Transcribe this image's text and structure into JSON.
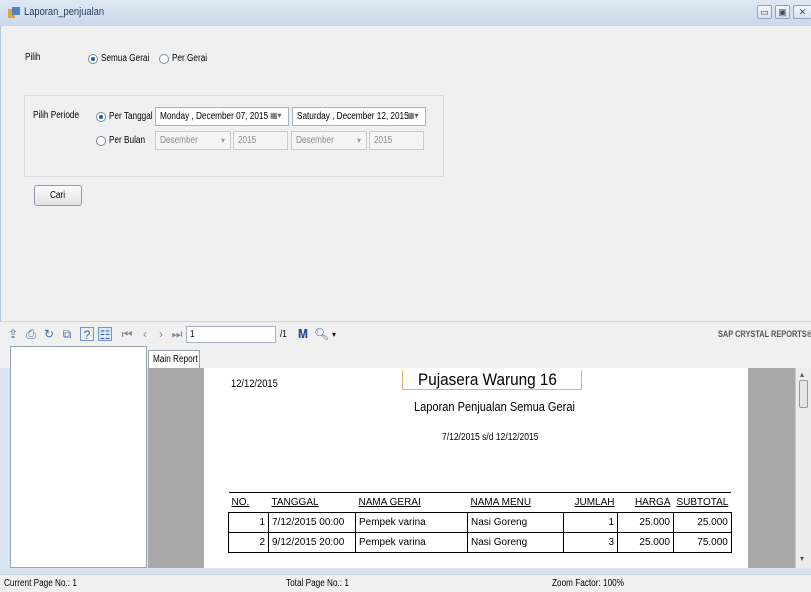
{
  "window": {
    "title": "Laporan_penjualan"
  },
  "filter": {
    "pilih_label": "Pilih",
    "opt_semua": "Semua Gerai",
    "opt_per_gerai": "Per Gerai",
    "selected": "Semua Gerai"
  },
  "periode": {
    "label": "Pilih Periode",
    "opt_tanggal": "Per Tanggal",
    "opt_bulan": "Per Bulan",
    "date_from": "Monday   , December 07, 2015",
    "date_to": "Saturday   , December 12, 2015",
    "month_from": "Desember",
    "year_from": "2015",
    "month_to": "Desember",
    "year_to": "2015"
  },
  "search_button": "Cari",
  "toolbar": {
    "page_input": "1",
    "page_total": "/1",
    "brand": "SAP CRYSTAL REPORTS®"
  },
  "tab": "Main Report",
  "report": {
    "print_date": "12/12/2015",
    "title": "Pujasera Warung 16",
    "subtitle": "Laporan Penjualan Semua Gerai",
    "range": "7/12/2015 s/d 12/12/2015",
    "columns": [
      "NO.",
      "TANGGAL",
      "NAMA GERAI",
      "NAMA MENU",
      "JUMLAH",
      "HARGA",
      "SUBTOTAL"
    ],
    "rows": [
      [
        "1",
        "7/12/2015  00:00",
        "Pempek varina",
        "Nasi Goreng",
        "1",
        "25.000",
        "25.000"
      ],
      [
        "2",
        "9/12/2015  20:00",
        "Pempek varina",
        "Nasi Goreng",
        "3",
        "25.000",
        "75.000"
      ]
    ]
  },
  "status": {
    "current_page": "Current Page No.: 1",
    "total_page": "Total Page No.: 1",
    "zoom": "Zoom Factor: 100%"
  }
}
